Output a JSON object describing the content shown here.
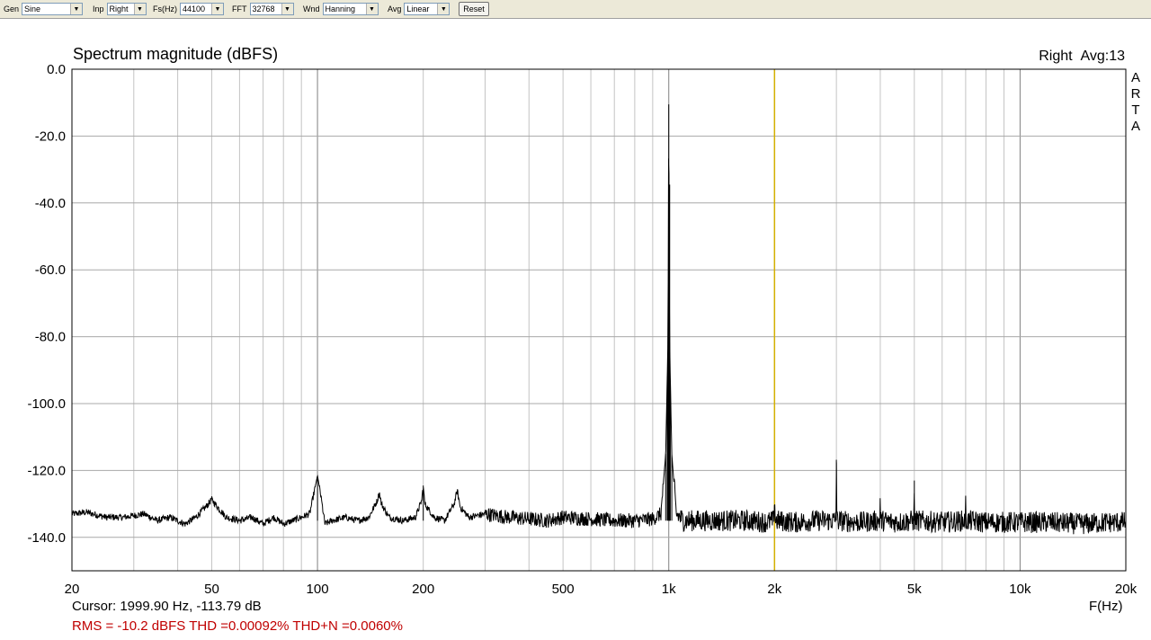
{
  "toolbar": {
    "gen": {
      "label": "Gen",
      "value": "Sine"
    },
    "inp": {
      "label": "Inp",
      "value": "Right"
    },
    "fs": {
      "label": "Fs(Hz)",
      "value": "44100"
    },
    "fft": {
      "label": "FFT",
      "value": "32768"
    },
    "wnd": {
      "label": "Wnd",
      "value": "Hanning"
    },
    "avg": {
      "label": "Avg",
      "value": "Linear"
    },
    "reset_label": "Reset"
  },
  "header": {
    "channel": "Right",
    "avg_count": "Avg:13",
    "brand_letters": [
      "A",
      "R",
      "T",
      "A"
    ]
  },
  "footer": {
    "cursor": "Cursor: 1999.90 Hz, -113.79 dB",
    "measurements": "RMS =  -10.2 dBFS  THD =0.00092%  THD+N =0.0060%"
  },
  "chart_data": {
    "type": "line",
    "title": "Spectrum magnitude (dBFS)",
    "xlabel": "F(Hz)",
    "ylabel": "",
    "x_scale": "log",
    "xlim": [
      20,
      20000
    ],
    "ylim": [
      -150,
      0
    ],
    "grid": true,
    "x_ticks": [
      {
        "value": 20,
        "label": "20"
      },
      {
        "value": 50,
        "label": "50"
      },
      {
        "value": 100,
        "label": "100"
      },
      {
        "value": 200,
        "label": "200"
      },
      {
        "value": 500,
        "label": "500"
      },
      {
        "value": 1000,
        "label": "1k"
      },
      {
        "value": 2000,
        "label": "2k"
      },
      {
        "value": 5000,
        "label": "5k"
      },
      {
        "value": 10000,
        "label": "10k"
      },
      {
        "value": 20000,
        "label": "20k"
      }
    ],
    "y_ticks": [
      {
        "value": 0,
        "label": "0.0"
      },
      {
        "value": -20,
        "label": "-20.0"
      },
      {
        "value": -40,
        "label": "-40.0"
      },
      {
        "value": -60,
        "label": "-60.0"
      },
      {
        "value": -80,
        "label": "-80.0"
      },
      {
        "value": -100,
        "label": "-100.0"
      },
      {
        "value": -120,
        "label": "-120.0"
      },
      {
        "value": -140,
        "label": "-140.0"
      }
    ],
    "cursor_x": 1999.9,
    "noise_floor_db": -135,
    "series_color": "#000000",
    "cursor_color": "#d4b000",
    "points": [
      [
        20,
        -133
      ],
      [
        22,
        -132.5
      ],
      [
        25,
        -134
      ],
      [
        28,
        -134
      ],
      [
        32,
        -133
      ],
      [
        35,
        -135
      ],
      [
        38,
        -134
      ],
      [
        42,
        -136
      ],
      [
        45,
        -134
      ],
      [
        48,
        -131
      ],
      [
        50,
        -128.7
      ],
      [
        52,
        -131
      ],
      [
        55,
        -134
      ],
      [
        60,
        -135
      ],
      [
        65,
        -134
      ],
      [
        70,
        -136
      ],
      [
        75,
        -134
      ],
      [
        80,
        -136
      ],
      [
        85,
        -135
      ],
      [
        90,
        -134
      ],
      [
        95,
        -133
      ],
      [
        98,
        -126
      ],
      [
        100,
        -121.5
      ],
      [
        102,
        -127
      ],
      [
        105,
        -136
      ],
      [
        110,
        -135
      ],
      [
        120,
        -134
      ],
      [
        130,
        -135
      ],
      [
        140,
        -134
      ],
      [
        148,
        -129
      ],
      [
        150,
        -126.5
      ],
      [
        152,
        -130
      ],
      [
        160,
        -134
      ],
      [
        175,
        -135
      ],
      [
        190,
        -134
      ],
      [
        198,
        -129
      ],
      [
        200,
        -124.5
      ],
      [
        202,
        -130
      ],
      [
        215,
        -134
      ],
      [
        230,
        -135
      ],
      [
        245,
        -130
      ],
      [
        250,
        -126
      ],
      [
        255,
        -131
      ],
      [
        270,
        -134
      ],
      [
        300,
        -133
      ],
      [
        350,
        -134
      ],
      [
        400,
        -134.5
      ],
      [
        450,
        -135
      ],
      [
        500,
        -134
      ],
      [
        600,
        -134.5
      ],
      [
        700,
        -135
      ],
      [
        800,
        -135
      ],
      [
        900,
        -134.5
      ],
      [
        950,
        -133
      ],
      [
        980,
        -115
      ],
      [
        990,
        -92
      ],
      [
        995,
        -80
      ],
      [
        1000,
        -10.5
      ],
      [
        1005,
        -80
      ],
      [
        1010,
        -92
      ],
      [
        1020,
        -115
      ],
      [
        1050,
        -133
      ],
      [
        1100,
        -135
      ],
      [
        1300,
        -135
      ],
      [
        1500,
        -135
      ],
      [
        1700,
        -135
      ],
      [
        1900,
        -135.5
      ],
      [
        1990,
        -135
      ],
      [
        2000,
        -127.5
      ],
      [
        2010,
        -135
      ],
      [
        2300,
        -135.5
      ],
      [
        2600,
        -135
      ],
      [
        2990,
        -135
      ],
      [
        3000,
        -116.8
      ],
      [
        3010,
        -135
      ],
      [
        3500,
        -135.5
      ],
      [
        3990,
        -135
      ],
      [
        4000,
        -127.5
      ],
      [
        4010,
        -135
      ],
      [
        4500,
        -135.5
      ],
      [
        4990,
        -135
      ],
      [
        5000,
        -123
      ],
      [
        5010,
        -135
      ],
      [
        6000,
        -135.5
      ],
      [
        6990,
        -135
      ],
      [
        7000,
        -128.5
      ],
      [
        7010,
        -135
      ],
      [
        8000,
        -135.5
      ],
      [
        10000,
        -135.5
      ],
      [
        12000,
        -135.5
      ],
      [
        15000,
        -136
      ],
      [
        18000,
        -135.5
      ],
      [
        20000,
        -135.5
      ]
    ]
  }
}
